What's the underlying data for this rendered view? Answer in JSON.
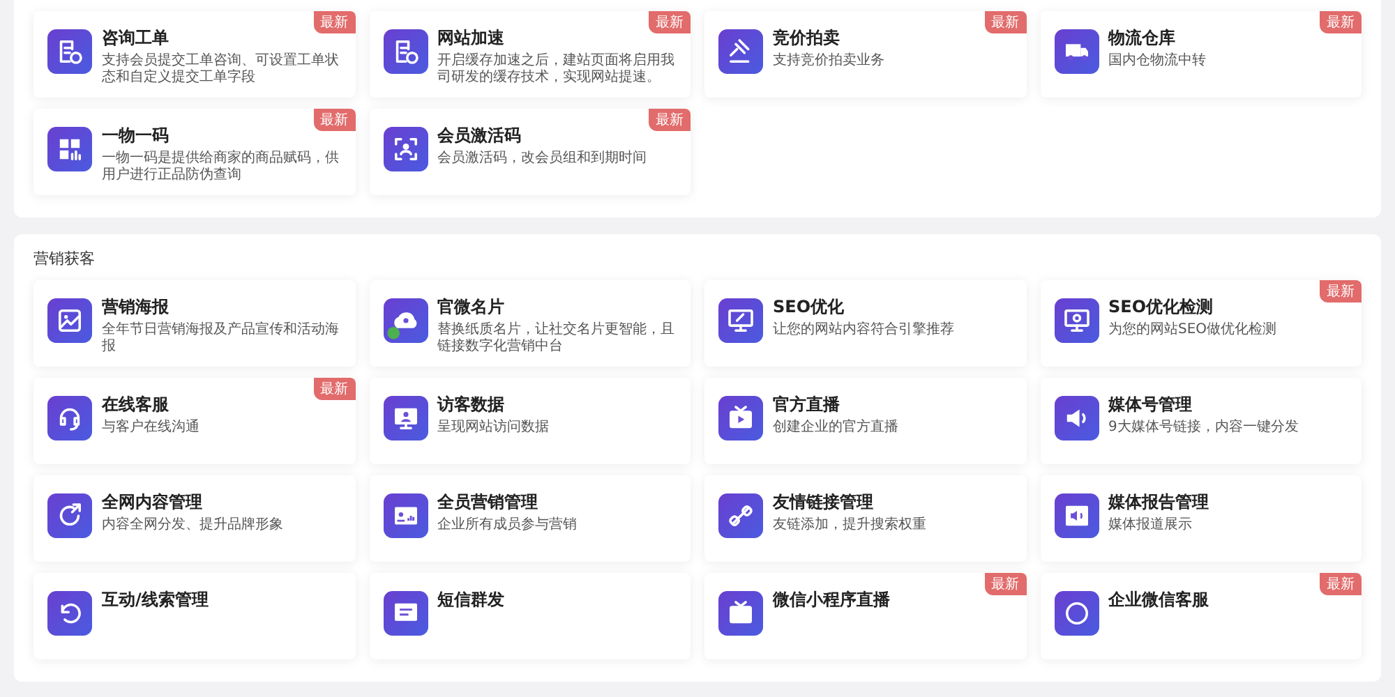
{
  "panels": [
    {
      "cards": [
        {
          "title": "咨询工单",
          "description": "支持会员提交工单咨询、可设置工单状态和自定义提交工单字段",
          "badge": "最新"
        },
        {
          "title": "网站加速",
          "description": "开启缓存加速之后，建站页面将启用我司研发的缓存技术，实现网站提速。",
          "badge": "最新"
        },
        {
          "title": "竞价拍卖",
          "description": "支持竞价拍卖业务",
          "badge": "最新"
        },
        {
          "title": "物流仓库",
          "description": "国内仓物流中转",
          "badge": "最新"
        },
        {
          "title": "一物一码",
          "description": "一物一码是提供给商家的商品赋码，供用户进行正品防伪查询",
          "badge": "最新"
        },
        {
          "title": "会员激活码",
          "description": "会员激活码，改会员组和到期时间",
          "badge": "最新"
        }
      ]
    },
    {
      "title": "营销获客",
      "cards": [
        {
          "title": "营销海报",
          "description": "全年节日营销海报及产品宣传和活动海报"
        },
        {
          "title": "官微名片",
          "description": "替换纸质名片，让社交名片更智能，且链接数字化营销中台"
        },
        {
          "title": "SEO优化",
          "description": "让您的网站内容符合引擎推荐"
        },
        {
          "title": "SEO优化检测",
          "description": "为您的网站SEO做优化检测",
          "badge": "最新"
        },
        {
          "title": "在线客服",
          "description": "与客户在线沟通",
          "badge": "最新"
        },
        {
          "title": "访客数据",
          "description": "呈现网站访问数据"
        },
        {
          "title": "官方直播",
          "description": "创建企业的官方直播"
        },
        {
          "title": "媒体号管理",
          "description": "9大媒体号链接，内容一键分发"
        },
        {
          "title": "全网内容管理",
          "description": "内容全网分发、提升品牌形象"
        },
        {
          "title": "全员营销管理",
          "description": "企业所有成员参与营销"
        },
        {
          "title": "友情链接管理",
          "description": "友链添加，提升搜索权重"
        },
        {
          "title": "媒体报告管理",
          "description": "媒体报道展示"
        },
        {
          "title": "互动/线索管理"
        },
        {
          "title": "短信群发"
        },
        {
          "title": "微信小程序直播",
          "badge": "最新"
        },
        {
          "title": "企业微信客服",
          "badge": "最新"
        }
      ]
    }
  ]
}
